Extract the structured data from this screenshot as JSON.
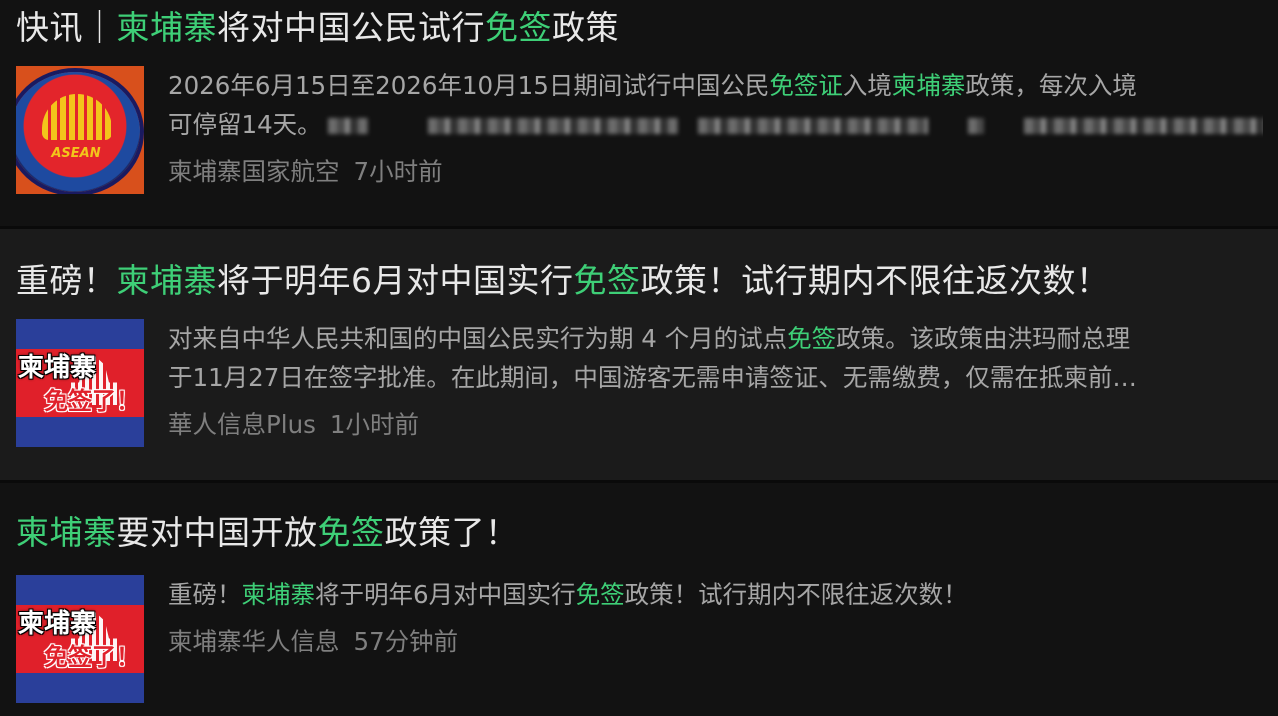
{
  "feed": [
    {
      "title_parts": [
        "快讯｜",
        "柬埔寨",
        "将对中国公民试行",
        "免签",
        "政策"
      ],
      "snippet_line1": [
        "2026年6月15日至2026年10月15日期间试行中国公民",
        "免签证",
        "入境",
        "柬埔寨",
        "政策，每次入境"
      ],
      "snippet_line2": "可停留14天。",
      "source": "柬埔寨国家航空",
      "time": "7小时前",
      "thumb_text": "ASEAN"
    },
    {
      "title_parts": [
        "重磅！",
        "柬埔寨",
        "将于明年6月对中国实行",
        "免签",
        "政策！试行期内不限往返次数！"
      ],
      "snippet_line1": [
        "对来自中华人民共和国的中国公民实行为期 4 个月的试点",
        "免签",
        "政策。该政策由洪玛耐总理"
      ],
      "snippet_line2": "于11月27日在签字批准。在此期间，中国游客无需申请签证、无需缴费，仅需在抵柬前…",
      "source": "華人信息Plus",
      "time": "1小时前",
      "thumb_text": [
        "柬埔寨",
        "免签了！"
      ]
    },
    {
      "title_parts": [
        "柬埔寨",
        "要对中国开放",
        "免签",
        "政策了！"
      ],
      "snippet_line1": [
        "重磅！",
        "柬埔寨",
        "将于明年6月对中国实行",
        "免签",
        "政策！试行期内不限往返次数！"
      ],
      "source": "柬埔寨华人信息",
      "time": "57分钟前",
      "thumb_text": [
        "柬埔寨",
        "免签了！"
      ]
    }
  ],
  "colors": {
    "background": "#121212",
    "highlight": "#3ecf77",
    "title": "#e8e8e8",
    "snippet": "#a6a6a6",
    "meta": "#7f7f7f"
  }
}
